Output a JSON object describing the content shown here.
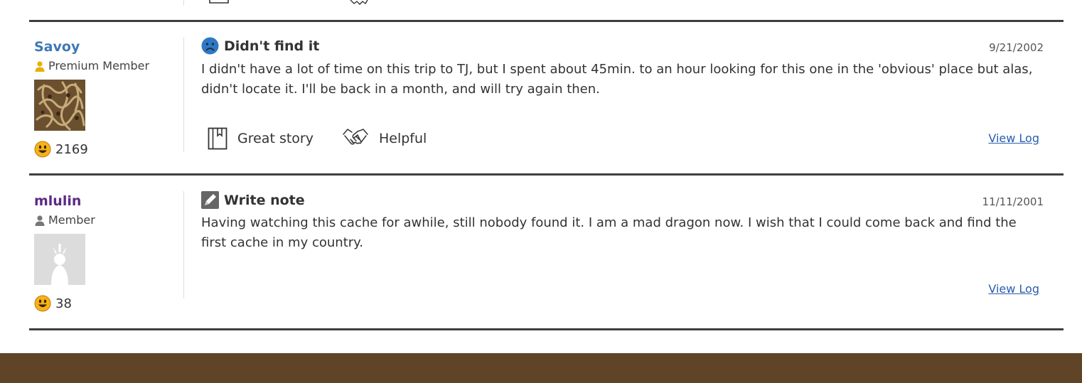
{
  "logs": [
    {
      "username": "Savoy",
      "username_color": "#3e78b5",
      "rank": "Premium Member",
      "rank_icon_color": "#e5b000",
      "find_count": "2169",
      "log_type": "Didn't find it",
      "log_type_icon": "frown-face-icon",
      "date": "9/21/2002",
      "text": "I didn't have a lot of time on this trip to TJ, but I spent about 45min. to an hour looking for this one in the 'obvious' place but alas, didn't locate it. I'll be back in a month, and will try again then.",
      "reactions": [
        "Great story",
        "Helpful"
      ],
      "view_log": "View Log"
    },
    {
      "username": "mlulin",
      "username_color": "#5b2a86",
      "rank": "Member",
      "rank_icon_color": "#777777",
      "find_count": "38",
      "log_type": "Write note",
      "log_type_icon": "pencil-note-icon",
      "date": "11/11/2001",
      "text": "Having watching this cache for awhile, still nobody found it. I am a mad dragon now. I wish that I could come back and find the first cache in my country.",
      "view_log": "View Log"
    }
  ],
  "colors": {
    "footer": "#5f4428",
    "link": "#2a5db0",
    "rule": "#3f3f3f"
  }
}
